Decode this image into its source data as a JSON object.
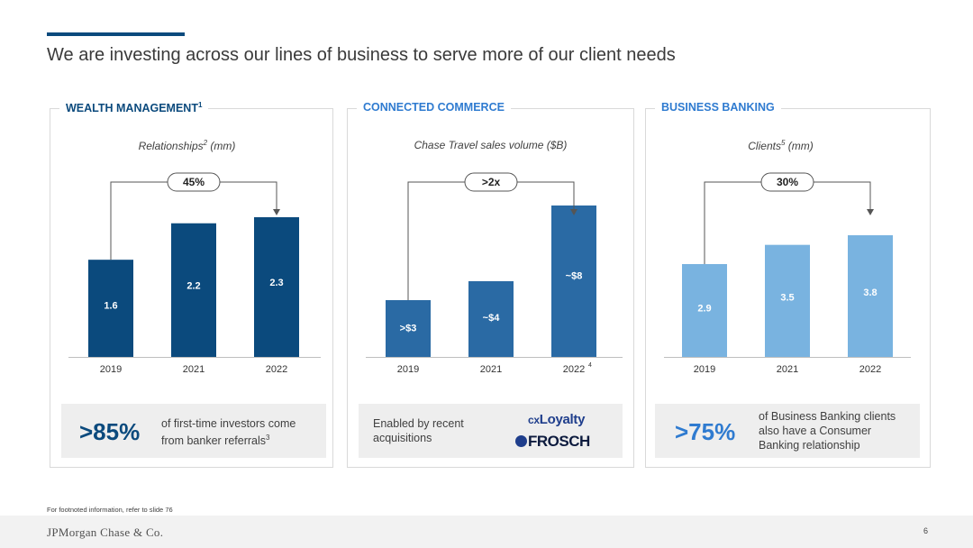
{
  "page": {
    "title": "We are investing across our lines of business to serve more of our client needs"
  },
  "colors": {
    "accent": "#0b4a7d",
    "wealth": "#0b4a7d",
    "commerce": "#2a6aa4",
    "business": "#79b3e0",
    "heading_light": "#2f7bd0"
  },
  "panels": [
    {
      "heading": "WEALTH MANAGEMENT",
      "heading_sup": "1",
      "chart_title": "Relationships",
      "chart_title_sup": "2",
      "chart_title_suffix": " (mm)",
      "growth": "45%",
      "callout_stat": ">85%",
      "callout_text_a": "of first-time investors come",
      "callout_text_b": "from banker referrals",
      "callout_sup": "3"
    },
    {
      "heading": "CONNECTED COMMERCE",
      "chart_title": "Chase Travel sales volume ($B)",
      "growth": ">2x",
      "x_sup": "4",
      "callout_text_a": "Enabled by recent",
      "callout_text_b": "acquisitions",
      "logo_cx": "cx",
      "logo_loyalty": "Loyalty",
      "logo_frosch": "FROSCH"
    },
    {
      "heading": "BUSINESS BANKING",
      "chart_title": "Clients",
      "chart_title_sup": "5",
      "chart_title_suffix": " (mm)",
      "growth": "30%",
      "callout_stat": ">75%",
      "callout_text_a": "of Business Banking clients",
      "callout_text_b": "also have a Consumer",
      "callout_text_c": "Banking relationship"
    }
  ],
  "chart_data": [
    {
      "type": "bar",
      "title": "Relationships2 (mm)",
      "categories": [
        "2019",
        "2021",
        "2022"
      ],
      "values": [
        1.6,
        2.2,
        2.3
      ],
      "labels": [
        "1.6",
        "2.2",
        "2.3"
      ],
      "ylim": [
        0,
        2.3
      ],
      "color": "#0b4a7d",
      "label_color": "#ffffff",
      "annotation": "45%"
    },
    {
      "type": "bar",
      "title": "Chase Travel sales volume ($B)",
      "categories": [
        "2019",
        "2021",
        "2022"
      ],
      "values": [
        3,
        4,
        8
      ],
      "labels": [
        ">$3",
        "~$4",
        "~$8"
      ],
      "ylim": [
        0,
        8
      ],
      "color": "#2a6aa4",
      "label_color": "#ffffff",
      "annotation": ">2x"
    },
    {
      "type": "bar",
      "title": "Clients5 (mm)",
      "categories": [
        "2019",
        "2021",
        "2022"
      ],
      "values": [
        2.9,
        3.5,
        3.8
      ],
      "labels": [
        "2.9",
        "3.5",
        "3.8"
      ],
      "ylim": [
        0,
        3.8
      ],
      "color": "#79b3e0",
      "label_color": "#ffffff",
      "annotation": "30%"
    }
  ],
  "footer": {
    "footnote": "For footnoted information, refer to slide 76",
    "logo": "JPMorgan Chase & Co.",
    "page_number": "6"
  }
}
